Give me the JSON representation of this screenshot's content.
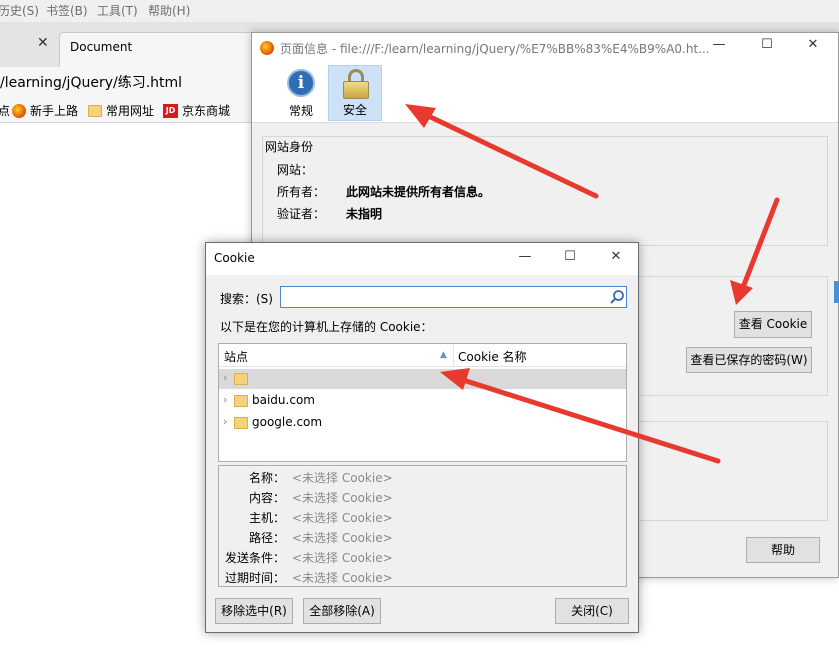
{
  "browser": {
    "menu": [
      "历史(S)",
      "书签(B)",
      "工具(T)",
      "帮助(H)"
    ],
    "tab_title": "Document",
    "url": "/learning/jQuery/练习.html",
    "bookmarks": [
      "点",
      "新手上路",
      "常用网址",
      "京东商城"
    ]
  },
  "page_info": {
    "title": "页面信息 - file:///F:/learn/learning/jQuery/%E7%BB%83%E4%B9%A0.ht...",
    "tabs": [
      {
        "label": "常规",
        "icon": "info-icon"
      },
      {
        "label": "安全",
        "icon": "lock-icon",
        "selected": true
      }
    ],
    "identity": {
      "legend": "网站身份",
      "site_label": "网站：",
      "site_value": "",
      "owner_label": "所有者：",
      "owner_value": "此网站未提供所有者信息。",
      "verifier_label": "验证者：",
      "verifier_value": "未指明"
    },
    "view_cookies": "查看 Cookie",
    "view_passwords": "查看已保存的密码(W)",
    "help": "帮助"
  },
  "cookie_dialog": {
    "title": "Cookie",
    "search_label": "搜索：(S)",
    "search_value": "",
    "list_caption": "以下是在您的计算机上存储的 Cookie：",
    "columns": [
      "站点",
      "Cookie 名称"
    ],
    "sites": [
      "",
      "baidu.com",
      "google.com"
    ],
    "details": [
      {
        "label": "名称：",
        "value": "<未选择 Cookie>"
      },
      {
        "label": "内容：",
        "value": "<未选择 Cookie>"
      },
      {
        "label": "主机：",
        "value": "<未选择 Cookie>"
      },
      {
        "label": "路径：",
        "value": "<未选择 Cookie>"
      },
      {
        "label": "发送条件：",
        "value": "<未选择 Cookie>"
      },
      {
        "label": "过期时间：",
        "value": "<未选择 Cookie>"
      }
    ],
    "remove_selected": "移除选中(R)",
    "remove_all": "全部移除(A)",
    "close": "关闭(C)"
  },
  "colors": {
    "accent": "#4a89c9",
    "selected_tab": "#cde2f7",
    "annotation_arrow": "#e8392f"
  }
}
